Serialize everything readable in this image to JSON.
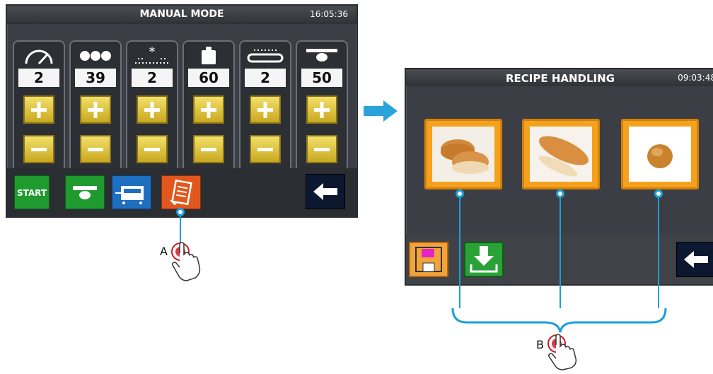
{
  "manual_mode": {
    "title": "MANUAL MODE",
    "clock": "16:05:36",
    "columns": [
      {
        "icon": "speed-gauge-icon",
        "value": "2"
      },
      {
        "icon": "dots-icon",
        "value": "39"
      },
      {
        "icon": "flour-sprinkle-icon",
        "value": "2"
      },
      {
        "icon": "weight-icon",
        "value": "60"
      },
      {
        "icon": "conveyor-icon",
        "value": "2"
      },
      {
        "icon": "press-icon",
        "value": "50"
      }
    ],
    "start_label": "START"
  },
  "recipe_handling": {
    "title": "RECIPE HANDLING",
    "clock": "09:03:48",
    "recipes": [
      "burger-buns-image",
      "hot-dog-bun-image",
      "round-roll-image"
    ]
  },
  "callouts": {
    "a_label": "A",
    "b_label": "B"
  },
  "colors": {
    "callout_line": "#1aa0d8",
    "button_yellow": "#e5c93a",
    "recipe_orange": "#f4a21d",
    "start_green": "#1f9a2e"
  }
}
